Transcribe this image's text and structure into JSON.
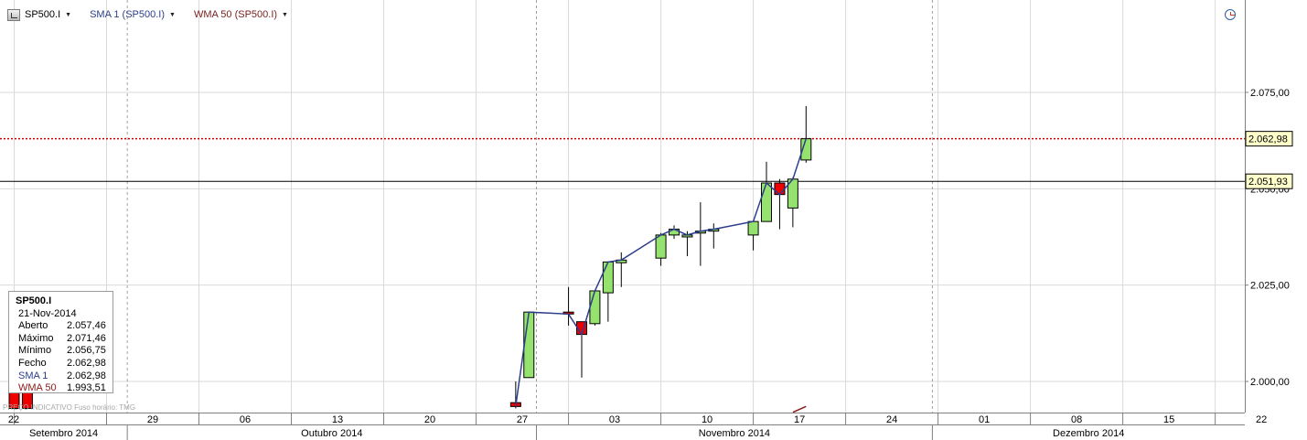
{
  "toolbar": {
    "symbol": "SP500.I",
    "sma_label": "SMA 1 (SP500.I)",
    "wma_label": "WMA 50 (SP500.I)",
    "symbol_color": "#000000",
    "sma_color": "#2c3e8c",
    "wma_color": "#7a1f1f"
  },
  "tooltip": {
    "title": "SP500.I",
    "date": "21-Nov-2014",
    "rows": [
      {
        "label": "Aberto",
        "value": "2.057,46"
      },
      {
        "label": "Máximo",
        "value": "2.071,46"
      },
      {
        "label": "Mínimo",
        "value": "2.056,75"
      },
      {
        "label": "Fecho",
        "value": "2.062,98"
      },
      {
        "label": "SMA 1",
        "value": "2.062,98"
      },
      {
        "label": "WMA 50",
        "value": "1.993,51"
      }
    ]
  },
  "footnote": "PREÇO INDICATIVO   Fuso horário: TMG",
  "price_labels": {
    "last": "2.062,98",
    "crosshair": "2.051,93"
  },
  "colors": {
    "up": "#96e26e",
    "down": "#ee0000",
    "sma": "#2c3e8c",
    "wma": "#8b1a1a",
    "last_price_line": "#cc0000",
    "grid": "#d9d9d9",
    "label_box": "#ffffcc"
  },
  "chart_data": {
    "type": "candlestick",
    "title": "SP500.I",
    "y_ticks": [
      "2.000,00",
      "2.025,00",
      "2.050,00",
      "2.075,00"
    ],
    "y_tick_values": [
      2000,
      2025,
      2050,
      2075
    ],
    "ylim": [
      1993,
      2100
    ],
    "x_ticks": [
      "22",
      "29",
      "06",
      "13",
      "20",
      "27",
      "03",
      "10",
      "17",
      "24",
      "01",
      "08",
      "15",
      "22"
    ],
    "months": [
      "Setembro 2014",
      "Outubro 2014",
      "Novembro 2014",
      "Dezembro 2014"
    ],
    "last_price": 2062.98,
    "crosshair_price": 2051.93,
    "candles": [
      {
        "date": "2014-09-22",
        "open": 1998.0,
        "high": 1998.0,
        "low": 1993.0,
        "close": 1993.0
      },
      {
        "date": "2014-09-23",
        "open": 1998.0,
        "high": 1998.0,
        "low": 1993.0,
        "close": 1993.0
      },
      {
        "date": "2014-10-30",
        "open": 1994.5,
        "high": 2000.0,
        "low": 1993.0,
        "close": 1993.5
      },
      {
        "date": "2014-10-31",
        "open": 2001.0,
        "high": 2018.0,
        "low": 2001.0,
        "close": 2018.0
      },
      {
        "date": "2014-11-03",
        "open": 2018.0,
        "high": 2024.5,
        "low": 2014.5,
        "close": 2017.5
      },
      {
        "date": "2014-11-04",
        "open": 2015.5,
        "high": 2015.5,
        "low": 2001.0,
        "close": 2012.2
      },
      {
        "date": "2014-11-05",
        "open": 2015.0,
        "high": 2023.5,
        "low": 2014.5,
        "close": 2023.5
      },
      {
        "date": "2014-11-06",
        "open": 2023.0,
        "high": 2031.0,
        "low": 2015.5,
        "close": 2031.0
      },
      {
        "date": "2014-11-07",
        "open": 2030.8,
        "high": 2033.5,
        "low": 2024.5,
        "close": 2031.5
      },
      {
        "date": "2014-11-10",
        "open": 2032.0,
        "high": 2038.5,
        "low": 2030.0,
        "close": 2038.0
      },
      {
        "date": "2014-11-11",
        "open": 2038.0,
        "high": 2040.5,
        "low": 2037.0,
        "close": 2039.5
      },
      {
        "date": "2014-11-12",
        "open": 2037.5,
        "high": 2039.0,
        "low": 2032.5,
        "close": 2038.0
      },
      {
        "date": "2014-11-13",
        "open": 2038.5,
        "high": 2046.5,
        "low": 2030.0,
        "close": 2039.0
      },
      {
        "date": "2014-11-14",
        "open": 2039.0,
        "high": 2041.0,
        "low": 2034.5,
        "close": 2039.5
      },
      {
        "date": "2014-11-17",
        "open": 2038.0,
        "high": 2041.0,
        "low": 2034.0,
        "close": 2041.5
      },
      {
        "date": "2014-11-18",
        "open": 2041.5,
        "high": 2057.0,
        "low": 2041.5,
        "close": 2051.5
      },
      {
        "date": "2014-11-19",
        "open": 2051.5,
        "high": 2052.5,
        "low": 2039.5,
        "close": 2048.5
      },
      {
        "date": "2014-11-20",
        "open": 2045.0,
        "high": 2053.0,
        "low": 2040.0,
        "close": 2052.5
      },
      {
        "date": "2014-11-21",
        "open": 2057.46,
        "high": 2071.46,
        "low": 2056.75,
        "close": 2062.98
      }
    ],
    "sma_1": [
      {
        "date": "2014-10-30",
        "value": 1993.5
      },
      {
        "date": "2014-10-31",
        "value": 2018.0
      },
      {
        "date": "2014-11-03",
        "value": 2017.5
      },
      {
        "date": "2014-11-04",
        "value": 2012.2
      },
      {
        "date": "2014-11-05",
        "value": 2023.5
      },
      {
        "date": "2014-11-06",
        "value": 2031.0
      },
      {
        "date": "2014-11-07",
        "value": 2031.5
      },
      {
        "date": "2014-11-10",
        "value": 2038.0
      },
      {
        "date": "2014-11-11",
        "value": 2039.5
      },
      {
        "date": "2014-11-12",
        "value": 2038.0
      },
      {
        "date": "2014-11-13",
        "value": 2039.0
      },
      {
        "date": "2014-11-14",
        "value": 2039.5
      },
      {
        "date": "2014-11-17",
        "value": 2041.5
      },
      {
        "date": "2014-11-18",
        "value": 2051.5
      },
      {
        "date": "2014-11-19",
        "value": 2048.5
      },
      {
        "date": "2014-11-20",
        "value": 2052.5
      },
      {
        "date": "2014-11-21",
        "value": 2062.98
      }
    ],
    "wma_50": [
      {
        "date": "2014-11-20",
        "value": 1992.0
      },
      {
        "date": "2014-11-21",
        "value": 1993.51
      }
    ]
  }
}
